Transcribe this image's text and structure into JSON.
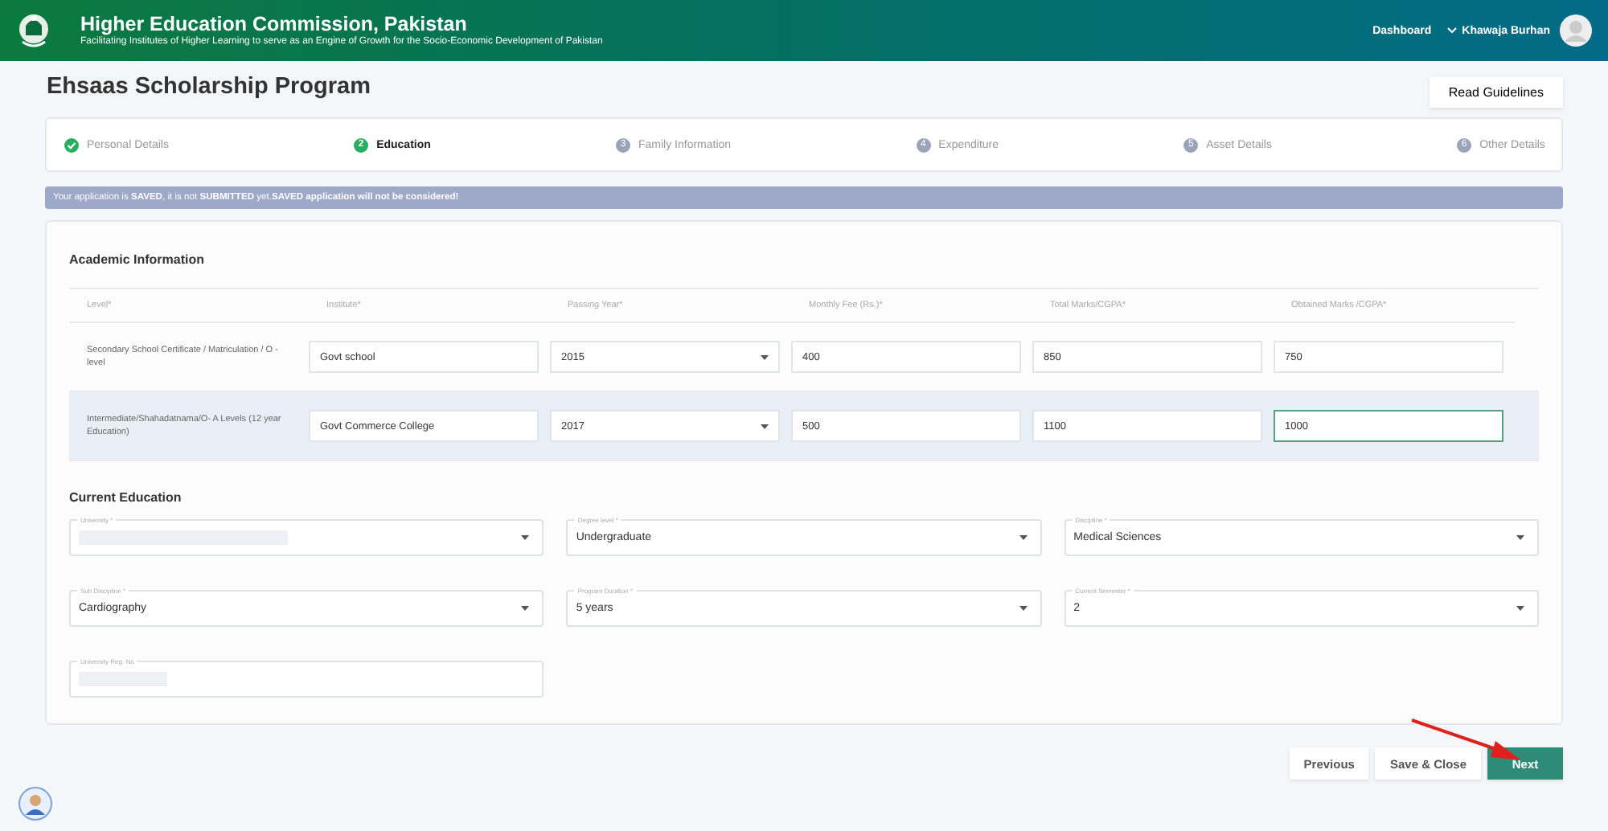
{
  "header": {
    "title": "Higher Education Commission, Pakistan",
    "subtitle": "Facilitating Institutes of Higher Learning to serve as an Engine of Growth for the Socio-Economic Development of Pakistan",
    "nav_link": "Dashboard",
    "user_name": "Khawaja Burhan"
  },
  "page_title": "Ehsaas Scholarship Program",
  "guidelines_button": "Read Guidelines",
  "steps": [
    {
      "label": "Personal Details",
      "completed": true,
      "selected": false
    },
    {
      "number": "2",
      "label": "Education",
      "completed": false,
      "selected": true
    },
    {
      "number": "3",
      "label": "Family Information",
      "completed": false,
      "selected": false
    },
    {
      "number": "4",
      "label": "Expenditure",
      "completed": false,
      "selected": false
    },
    {
      "number": "5",
      "label": "Asset Details",
      "completed": false,
      "selected": false
    },
    {
      "number": "6",
      "label": "Other Details",
      "completed": false,
      "selected": false
    }
  ],
  "notice": "Your application is **SAVED**, it is not **SUBMITTED** yet.**SAVED application will not be considered!**",
  "academic": {
    "heading": "Academic Information",
    "columns": [
      "Level*",
      "Institute*",
      "Passing Year*",
      "Monthly Fee (Rs.)*",
      "Total Marks/CGPA*",
      "Obtained Marks /CGPA*"
    ],
    "rows": [
      {
        "level": "Secondary School Certificate / Matriculation / O - level",
        "highlighted": false,
        "fields": [
          {
            "kind": "text",
            "value": "Govt school",
            "focused": false
          },
          {
            "kind": "select",
            "value": "2015",
            "focused": false
          },
          {
            "kind": "text",
            "value": "400",
            "focused": false
          },
          {
            "kind": "text",
            "value": "850",
            "focused": false
          },
          {
            "kind": "text",
            "value": "750",
            "focused": false
          }
        ]
      },
      {
        "level": "Intermediate/Shahadatnama/O- A Levels (12 year Education)",
        "highlighted": true,
        "fields": [
          {
            "kind": "text",
            "value": "Govt Commerce College",
            "focused": false
          },
          {
            "kind": "select",
            "value": "2017",
            "focused": false
          },
          {
            "kind": "text",
            "value": "500",
            "focused": false
          },
          {
            "kind": "text",
            "value": "1100",
            "focused": false
          },
          {
            "kind": "text",
            "value": "1000",
            "focused": true
          }
        ]
      }
    ]
  },
  "current": {
    "heading": "Current Education",
    "fields": [
      {
        "kind": "select",
        "label": "University *",
        "redacted": true
      },
      {
        "kind": "select",
        "label": "Degree level *",
        "value": "Undergraduate",
        "redacted": false
      },
      {
        "kind": "select",
        "label": "Discipline *",
        "value": "Medical Sciences",
        "redacted": false
      },
      {
        "kind": "select",
        "label": "Sub Discipline *",
        "value": "Cardiography",
        "redacted": false
      },
      {
        "kind": "select",
        "label": "Program Duration *",
        "value": "5 years",
        "redacted": false
      },
      {
        "kind": "select",
        "label": "Current Semester *",
        "value": "2",
        "redacted": false
      },
      {
        "kind": "text",
        "label": "University Reg. No",
        "redacted": true
      }
    ]
  },
  "buttons": [
    {
      "label": "Previous",
      "kind": "secondary"
    },
    {
      "label": "Save & Close",
      "kind": "secondary"
    },
    {
      "label": "Next",
      "kind": "primary"
    }
  ]
}
